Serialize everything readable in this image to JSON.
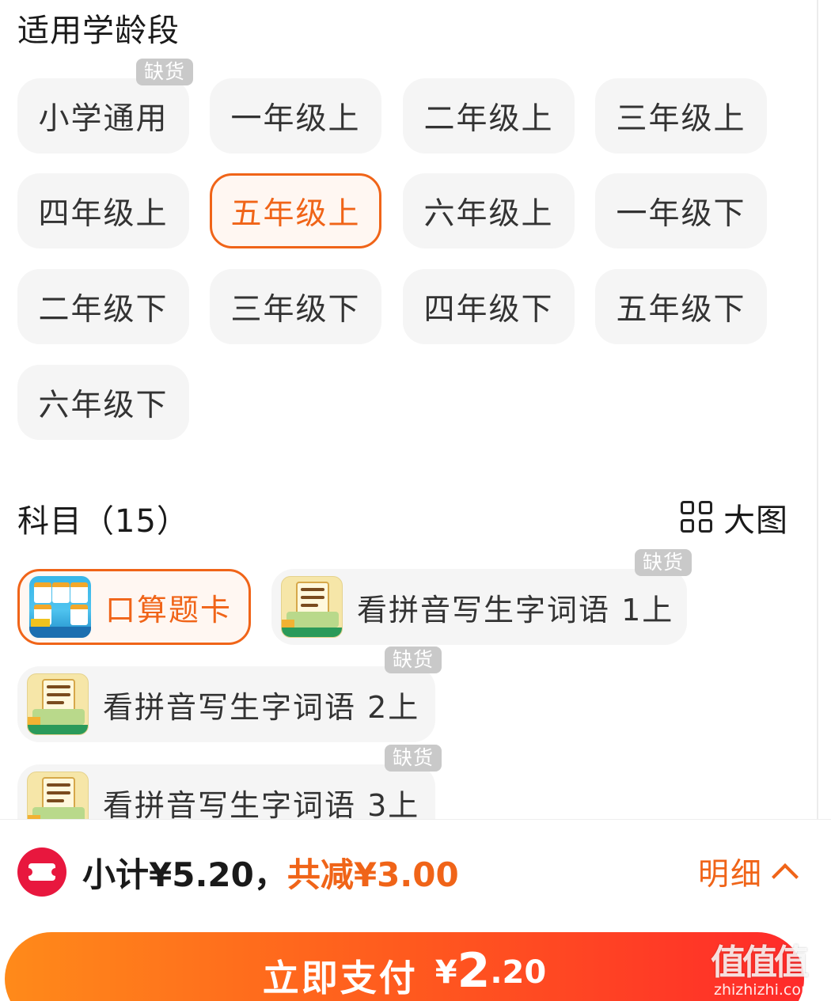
{
  "age_section": {
    "title": "适用学龄段"
  },
  "grades": [
    {
      "label": "小学通用",
      "out_of_stock": true,
      "selected": false
    },
    {
      "label": "一年级上",
      "out_of_stock": false,
      "selected": false
    },
    {
      "label": "二年级上",
      "out_of_stock": false,
      "selected": false
    },
    {
      "label": "三年级上",
      "out_of_stock": false,
      "selected": false
    },
    {
      "label": "四年级上",
      "out_of_stock": false,
      "selected": false
    },
    {
      "label": "五年级上",
      "out_of_stock": false,
      "selected": true
    },
    {
      "label": "六年级上",
      "out_of_stock": false,
      "selected": false
    },
    {
      "label": "一年级下",
      "out_of_stock": false,
      "selected": false
    },
    {
      "label": "二年级下",
      "out_of_stock": false,
      "selected": false
    },
    {
      "label": "三年级下",
      "out_of_stock": false,
      "selected": false
    },
    {
      "label": "四年级下",
      "out_of_stock": false,
      "selected": false
    },
    {
      "label": "五年级下",
      "out_of_stock": false,
      "selected": false
    },
    {
      "label": "六年级下",
      "out_of_stock": false,
      "selected": false
    }
  ],
  "out_of_stock_badge": "缺货",
  "subjects": {
    "title": "科目（15）",
    "big_view_label": "大图",
    "big_view_icon": "grid-icon",
    "items": [
      {
        "label": "口算题卡",
        "selected": true,
        "out_of_stock": false,
        "thumb": "calc-cards"
      },
      {
        "label": "看拼音写生字词语 1上",
        "selected": false,
        "out_of_stock": true,
        "thumb": "pinyin-book"
      },
      {
        "label": "看拼音写生字词语 2上",
        "selected": false,
        "out_of_stock": true,
        "thumb": "pinyin-book"
      },
      {
        "label": "看拼音写生字词语 3上",
        "selected": false,
        "out_of_stock": true,
        "thumb": "pinyin-book"
      }
    ]
  },
  "footer": {
    "coupon_icon": "coupon-icon",
    "subtotal_label": "小计¥5.20，",
    "saving_label": "共减¥3.00",
    "detail_label": "明细",
    "pay": {
      "label": "立即支付",
      "currency": "¥",
      "amount_int": "2",
      "amount_dec": ".20"
    }
  },
  "watermark": {
    "mark": "值值值",
    "domain": "zhizhizhi.com"
  },
  "colors": {
    "accent": "#f06418",
    "chip_bg": "#f5f5f5",
    "badge_bg": "#c9c9c9",
    "coupon_red": "#e8173e"
  }
}
